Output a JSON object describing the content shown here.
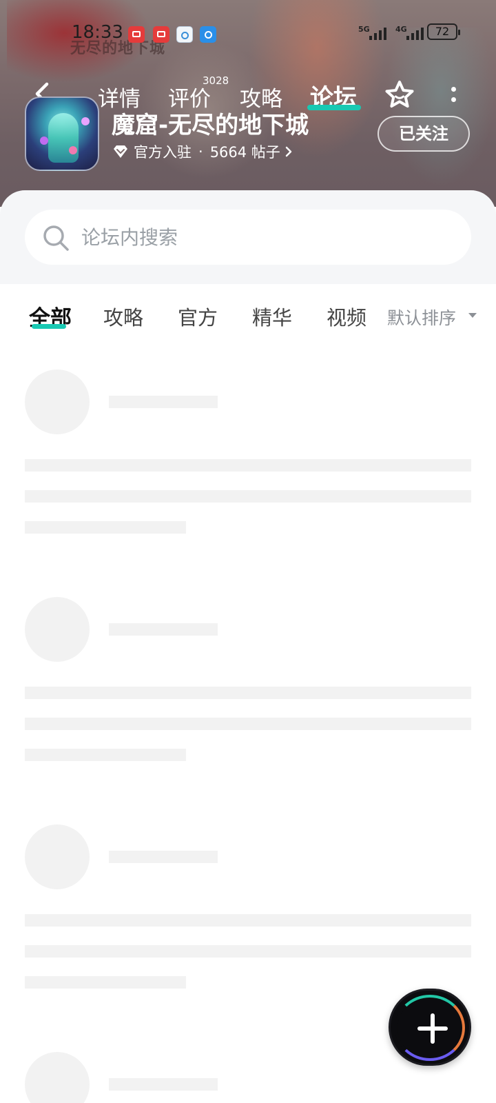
{
  "status_bar": {
    "time": "18:33",
    "battery": "72",
    "signal_1": "5G",
    "signal_2": "4G"
  },
  "header": {
    "background_text": "无尽的地下城",
    "nav_tabs": [
      {
        "label": "详情"
      },
      {
        "label": "评价",
        "badge": "3028"
      },
      {
        "label": "攻略"
      },
      {
        "label": "论坛",
        "active": true
      }
    ],
    "game": {
      "name": "魔窟-无尽的地下城",
      "official": "官方入驻",
      "separator": "·",
      "posts": "5664 帖子"
    },
    "follow_button": "已关注"
  },
  "search": {
    "placeholder": "论坛内搜索"
  },
  "filters": {
    "tabs": [
      "全部",
      "攻略",
      "官方",
      "精华",
      "视频"
    ],
    "active": "全部",
    "sort_label": "默认排序"
  },
  "icons": {
    "back": "back-arrow-icon",
    "favorite": "star-icon",
    "more": "more-vertical-icon",
    "official": "diamond-icon",
    "search": "search-icon",
    "create": "plus-icon"
  },
  "colors": {
    "accent": "#19c9b3",
    "placeholder_gray": "#f2f2f2",
    "text_gray": "#8c9096"
  }
}
